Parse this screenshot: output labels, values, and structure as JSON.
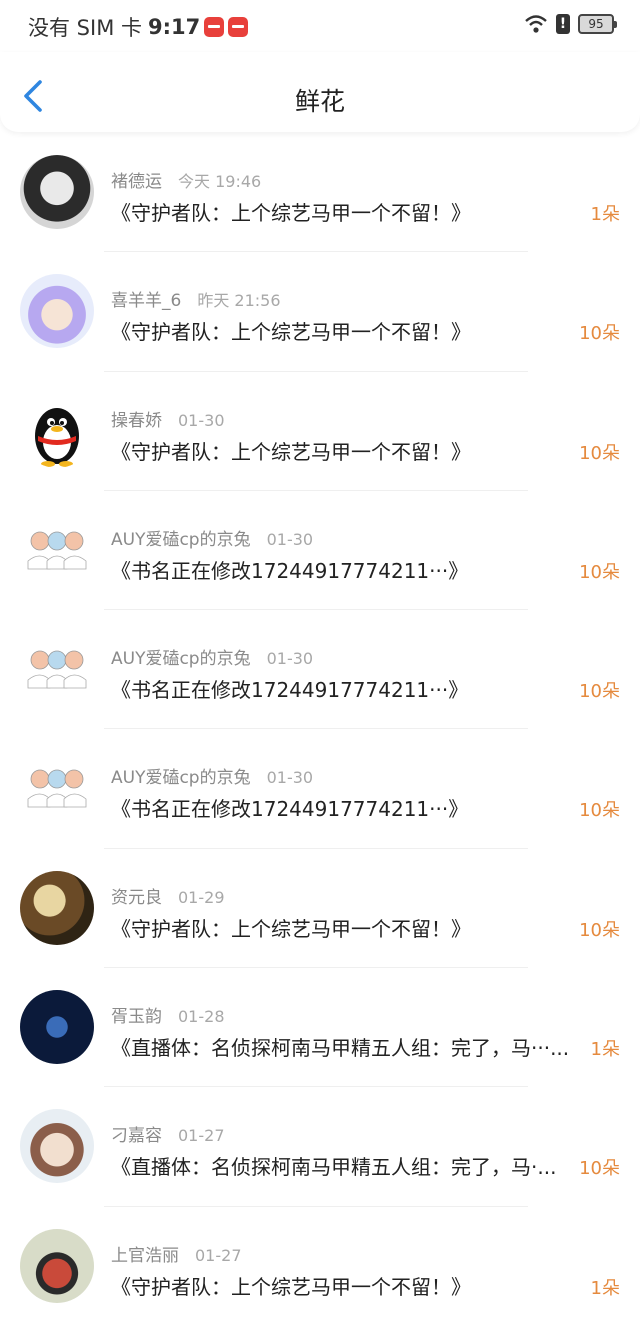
{
  "status_bar": {
    "carrier": "没有 SIM 卡",
    "time": "9:17",
    "battery": "95"
  },
  "header": {
    "title": "鲜花"
  },
  "items": [
    {
      "name": "褚德运",
      "date": "今天 19:46",
      "title": "《守护者队：上个综艺马甲一个不留！》",
      "count": "1朵",
      "avatar": "avatar-photo-boy"
    },
    {
      "name": "喜羊羊_6",
      "date": "昨天 21:56",
      "title": "《守护者队：上个综艺马甲一个不留！》",
      "count": "10朵",
      "avatar": "avatar-anime-girl"
    },
    {
      "name": "操春娇",
      "date": "01-30",
      "title": "《守护者队：上个综艺马甲一个不留！》",
      "count": "10朵",
      "avatar": "qq-penguin-icon"
    },
    {
      "name": "AUY爱磕cp的京兔",
      "date": "01-30",
      "title": "《书名正在修改17244917774211···》",
      "count": "10朵",
      "avatar": "avatar-sketch-babies"
    },
    {
      "name": "AUY爱磕cp的京兔",
      "date": "01-30",
      "title": "《书名正在修改17244917774211···》",
      "count": "10朵",
      "avatar": "avatar-sketch-babies"
    },
    {
      "name": "AUY爱磕cp的京兔",
      "date": "01-30",
      "title": "《书名正在修改17244917774211···》",
      "count": "10朵",
      "avatar": "avatar-sketch-babies"
    },
    {
      "name": "资元良",
      "date": "01-29",
      "title": "《守护者队：上个综艺马甲一个不留！》",
      "count": "10朵",
      "avatar": "avatar-photo-girl"
    },
    {
      "name": "胥玉韵",
      "date": "01-28",
      "title": "《直播体：名侦探柯南马甲精五人组：完了，马···...",
      "count": "1朵",
      "avatar": "avatar-calligraphy"
    },
    {
      "name": "刁嘉容",
      "date": "01-27",
      "title": "《直播体：名侦探柯南马甲精五人组：完了，马·...",
      "count": "10朵",
      "avatar": "avatar-cartoon-kid"
    },
    {
      "name": "上官浩丽",
      "date": "01-27",
      "title": "《守护者队：上个综艺马甲一个不留！》",
      "count": "1朵",
      "avatar": "avatar-photo-man"
    }
  ]
}
